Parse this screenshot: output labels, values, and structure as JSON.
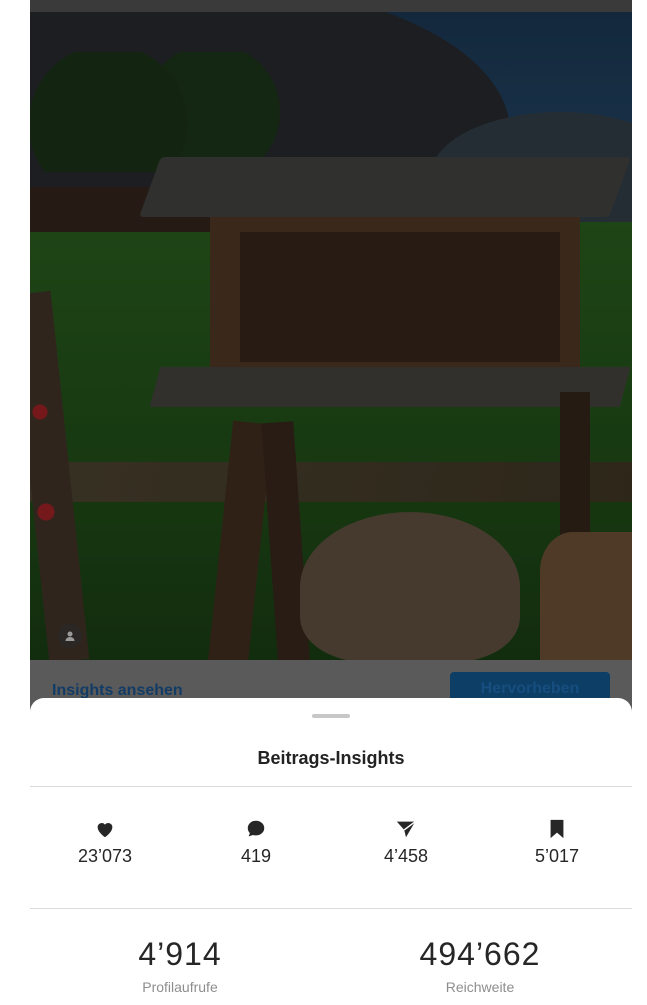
{
  "action_bar": {
    "insights_link": "Insights ansehen",
    "promote_button": "Hervorheben"
  },
  "sheet": {
    "title": "Beitrags-Insights",
    "stats": [
      {
        "icon": "heart-icon",
        "value": "23’073"
      },
      {
        "icon": "comment-icon",
        "value": "419"
      },
      {
        "icon": "share-icon",
        "value": "4’458"
      },
      {
        "icon": "bookmark-icon",
        "value": "5’017"
      }
    ],
    "profile_visits": {
      "value": "4’914",
      "label": "Profilaufrufe"
    },
    "reach": {
      "value": "494’662",
      "label": "Reichweite"
    }
  }
}
